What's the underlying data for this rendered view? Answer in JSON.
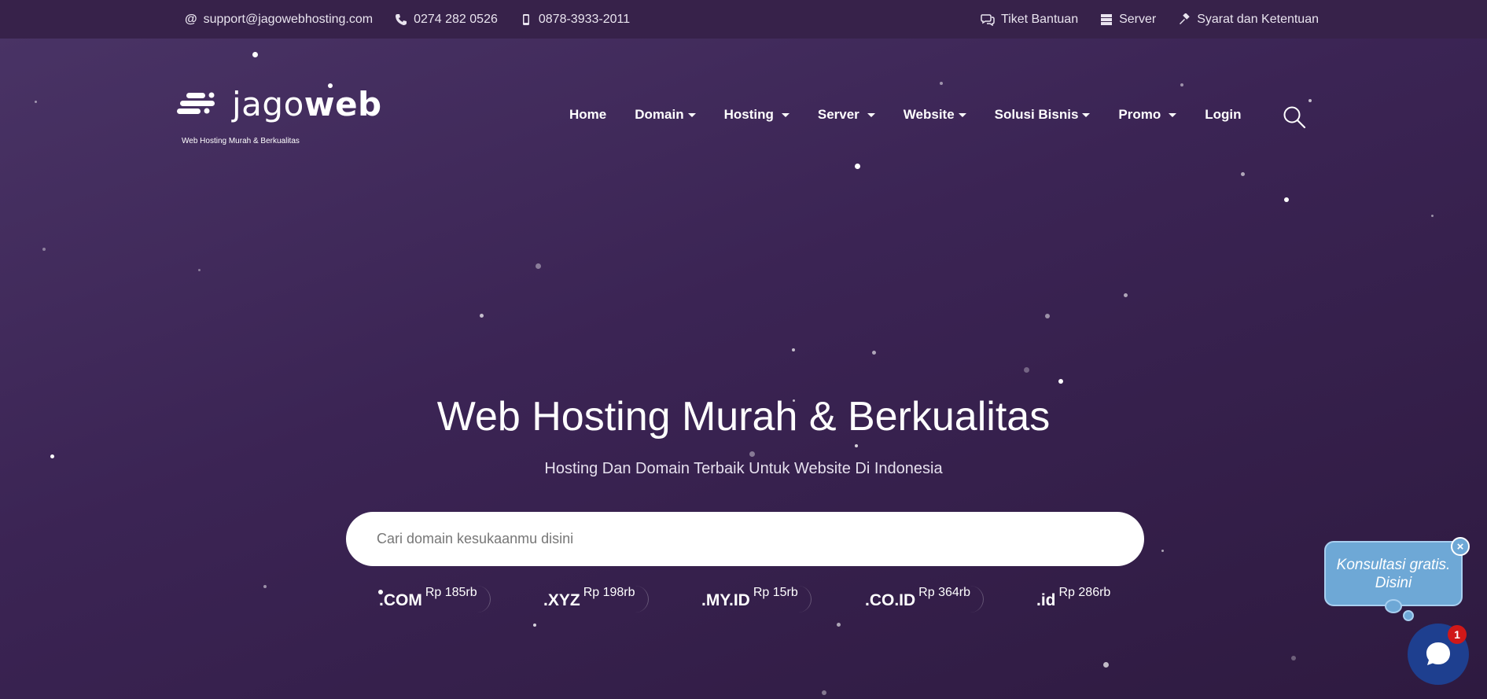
{
  "topbar": {
    "email": "support@jagowebhosting.com",
    "phone": "0274 282 0526",
    "mobile": "0878-3933-2011",
    "links": [
      {
        "label": "Tiket Bantuan",
        "icon": "chat-icon"
      },
      {
        "label": "Server",
        "icon": "server-icon"
      },
      {
        "label": "Syarat dan Ketentuan",
        "icon": "gavel-icon"
      }
    ]
  },
  "logo": {
    "text_light": "jago",
    "text_bold": "web",
    "tagline": "Web Hosting Murah & Berkualitas"
  },
  "nav": {
    "items": [
      {
        "label": "Home",
        "dropdown": false
      },
      {
        "label": "Domain",
        "dropdown": true
      },
      {
        "label": "Hosting",
        "dropdown": true
      },
      {
        "label": "Server",
        "dropdown": true
      },
      {
        "label": "Website",
        "dropdown": true
      },
      {
        "label": "Solusi Bisnis",
        "dropdown": true
      },
      {
        "label": "Promo",
        "dropdown": true
      },
      {
        "label": "Login",
        "dropdown": false
      }
    ]
  },
  "hero": {
    "title": "Web Hosting Murah & Berkualitas",
    "subtitle": "Hosting Dan Domain Terbaik Untuk Website Di Indonesia",
    "search_placeholder": "Cari domain kesukaanmu disini"
  },
  "tlds": [
    {
      "name": ".COM",
      "price": "Rp 185rb"
    },
    {
      "name": ".XYZ",
      "price": "Rp 198rb"
    },
    {
      "name": ".MY.ID",
      "price": "Rp 15rb"
    },
    {
      "name": ".CO.ID",
      "price": "Rp 364rb"
    },
    {
      "name": ".id",
      "price": "Rp 286rb"
    }
  ],
  "chat": {
    "bubble_text": "Konsultasi gratis. Disini",
    "close_label": "×",
    "badge_count": "1"
  },
  "colors": {
    "background": "#3b2454",
    "topbar": "#37224a",
    "chat_bubble": "#6ea8d6",
    "chat_button": "#1e3f8f",
    "badge": "#d01818"
  }
}
